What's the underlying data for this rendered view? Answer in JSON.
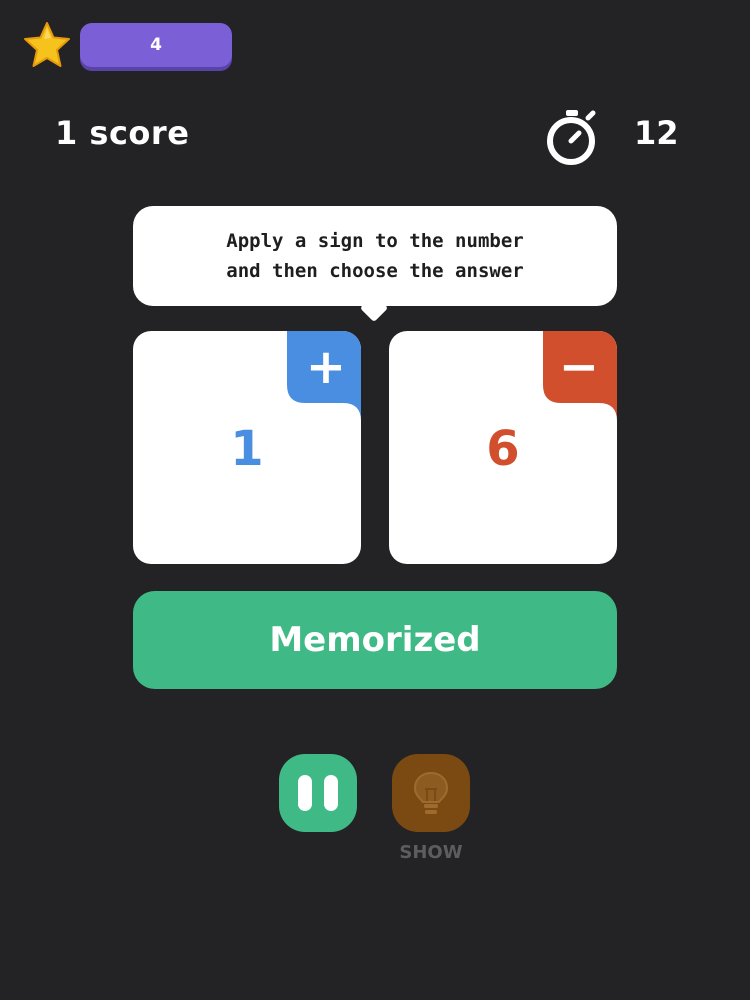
{
  "level": "4",
  "score_text": "1 score",
  "timer": "12",
  "instruction": {
    "line1": "Apply a sign to the number",
    "line2": "and then choose the answer"
  },
  "cards": [
    {
      "sign": "+",
      "number": "1",
      "color": "#4a8ee2"
    },
    {
      "sign": "−",
      "number": "6",
      "color": "#d14f2c"
    }
  ],
  "memorized_label": "Memorized",
  "hint_label": "SHOW",
  "colors": {
    "background": "#232224",
    "accent_green": "#3fba86",
    "level_purple": "#7b5fd6",
    "hint_brown": "#7a4a12"
  }
}
